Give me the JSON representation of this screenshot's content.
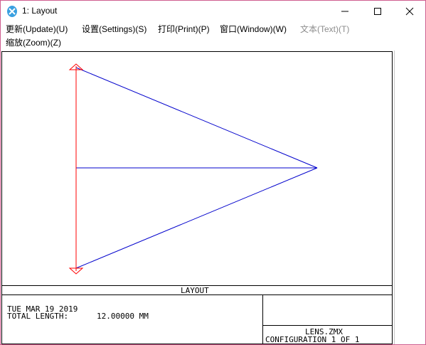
{
  "window": {
    "title": "1: Layout",
    "icon": "zemax-logo-icon"
  },
  "menubar": {
    "items": [
      {
        "label": "更新(Update)(U)",
        "enabled": true
      },
      {
        "label": "设置(Settings)(S)",
        "enabled": true
      },
      {
        "label": "打印(Print)(P)",
        "enabled": true
      },
      {
        "label": "窗口(Window)(W)",
        "enabled": true
      },
      {
        "label": "文本(Text)(T)",
        "enabled": false
      },
      {
        "label": "缩放(Zoom)(Z)",
        "enabled": true
      }
    ]
  },
  "plot": {
    "caption": "LAYOUT",
    "date": "TUE MAR 19 2019",
    "total_length_label": "TOTAL LENGTH:",
    "total_length_value": "12.00000 MM",
    "file_name": "LENS.ZMX",
    "configuration": "CONFIGURATION 1 OF 1",
    "colors": {
      "rays": "#0000cc",
      "lens": "#ff0000",
      "frame": "#000000"
    }
  }
}
